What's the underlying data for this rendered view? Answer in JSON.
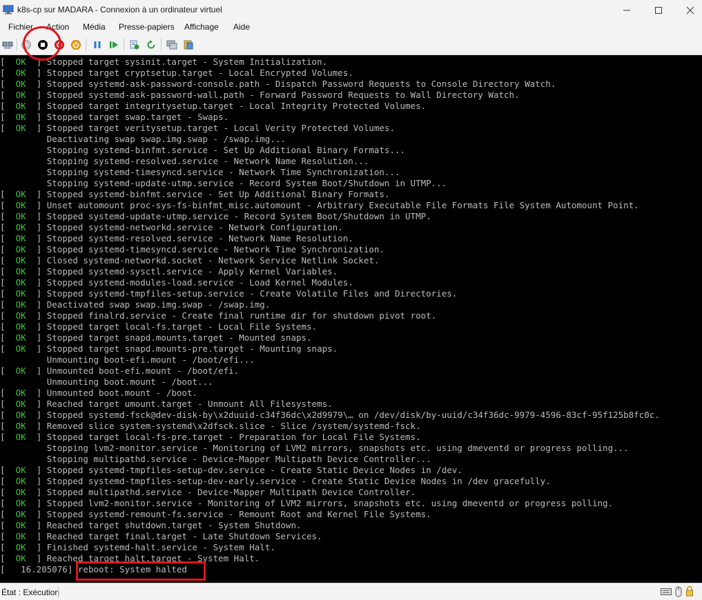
{
  "window": {
    "title": "k8s-cp sur MADARA - Connexion à un ordinateur virtuel"
  },
  "menu": [
    {
      "label": "Fichier"
    },
    {
      "label": "Action"
    },
    {
      "label": "Média"
    },
    {
      "label": "Presse-papiers"
    },
    {
      "label": "Affichage"
    },
    {
      "label": "Aide"
    }
  ],
  "toolbar": {
    "icons": [
      "ctrl-alt-del-icon",
      "start-icon",
      "turn-off-icon",
      "shutdown-icon",
      "power-icon",
      "pause-icon",
      "resume-icon",
      "checkpoint-icon",
      "revert-icon",
      "enhanced-session-icon",
      "share-icon"
    ],
    "highlighted": "turn-off-icon"
  },
  "colors": {
    "ok": "#3fc53f",
    "console_text": "#bcbcbc",
    "console_bg": "#000000",
    "annotation": "#e0141c"
  },
  "console": {
    "lines": [
      {
        "ok": true,
        "text": "Stopped target sysinit.target - System Initialization."
      },
      {
        "ok": true,
        "text": "Stopped target cryptsetup.target - Local Encrypted Volumes."
      },
      {
        "ok": true,
        "text": "Stopped systemd-ask-password-console.path - Dispatch Password Requests to Console Directory Watch."
      },
      {
        "ok": true,
        "text": "Stopped systemd-ask-password-wall.path - Forward Password Requests to Wall Directory Watch."
      },
      {
        "ok": true,
        "text": "Stopped target integritysetup.target - Local Integrity Protected Volumes."
      },
      {
        "ok": true,
        "text": "Stopped target swap.target - Swaps."
      },
      {
        "ok": true,
        "text": "Stopped target veritysetup.target - Local Verity Protected Volumes."
      },
      {
        "ok": false,
        "text": "Deactivating swap swap.img.swap - /swap.img..."
      },
      {
        "ok": false,
        "text": "Stopping systemd-binfmt.service - Set Up Additional Binary Formats..."
      },
      {
        "ok": false,
        "text": "Stopping systemd-resolved.service - Network Name Resolution..."
      },
      {
        "ok": false,
        "text": "Stopping systemd-timesyncd.service - Network Time Synchronization..."
      },
      {
        "ok": false,
        "text": "Stopping systemd-update-utmp.service - Record System Boot/Shutdown in UTMP..."
      },
      {
        "ok": true,
        "text": "Stopped systemd-binfmt.service - Set Up Additional Binary Formats."
      },
      {
        "ok": true,
        "text": "Unset automount proc-sys-fs-binfmt_misc.automount - Arbitrary Executable File Formats File System Automount Point."
      },
      {
        "ok": true,
        "text": "Stopped systemd-update-utmp.service - Record System Boot/Shutdown in UTMP."
      },
      {
        "ok": true,
        "text": "Stopped systemd-networkd.service - Network Configuration."
      },
      {
        "ok": true,
        "text": "Stopped systemd-resolved.service - Network Name Resolution."
      },
      {
        "ok": true,
        "text": "Stopped systemd-timesyncd.service - Network Time Synchronization."
      },
      {
        "ok": true,
        "text": "Closed systemd-networkd.socket - Network Service Netlink Socket."
      },
      {
        "ok": true,
        "text": "Stopped systemd-sysctl.service - Apply Kernel Variables."
      },
      {
        "ok": true,
        "text": "Stopped systemd-modules-load.service - Load Kernel Modules."
      },
      {
        "ok": true,
        "text": "Stopped systemd-tmpfiles-setup.service - Create Volatile Files and Directories."
      },
      {
        "ok": true,
        "text": "Deactivated swap swap.img.swap - /swap.img."
      },
      {
        "ok": true,
        "text": "Stopped finalrd.service - Create final runtime dir for shutdown pivot root."
      },
      {
        "ok": true,
        "text": "Stopped target local-fs.target - Local File Systems."
      },
      {
        "ok": true,
        "text": "Stopped target snapd.mounts.target - Mounted snaps."
      },
      {
        "ok": true,
        "text": "Stopped target snapd.mounts-pre.target - Mounting snaps."
      },
      {
        "ok": false,
        "text": "Unmounting boot-efi.mount - /boot/efi..."
      },
      {
        "ok": true,
        "text": "Unmounted boot-efi.mount - /boot/efi."
      },
      {
        "ok": false,
        "text": "Unmounting boot.mount - /boot..."
      },
      {
        "ok": true,
        "text": "Unmounted boot.mount - /boot."
      },
      {
        "ok": true,
        "text": "Reached target umount.target - Unmount All Filesystems."
      },
      {
        "ok": true,
        "text": "Stopped systemd-fsck@dev-disk-by\\x2duuid-c34f36dc\\x2d9979\\… on /dev/disk/by-uuid/c34f36dc-9979-4596-83cf-95f125b8fc0c."
      },
      {
        "ok": true,
        "text": "Removed slice system-systemd\\x2dfsck.slice - Slice /system/systemd-fsck."
      },
      {
        "ok": true,
        "text": "Stopped target local-fs-pre.target - Preparation for Local File Systems."
      },
      {
        "ok": false,
        "text": "Stopping lvm2-monitor.service - Monitoring of LVM2 mirrors, snapshots etc. using dmeventd or progress polling..."
      },
      {
        "ok": false,
        "text": "Stopping multipathd.service - Device-Mapper Multipath Device Controller..."
      },
      {
        "ok": true,
        "text": "Stopped systemd-tmpfiles-setup-dev.service - Create Static Device Nodes in /dev."
      },
      {
        "ok": true,
        "text": "Stopped systemd-tmpfiles-setup-dev-early.service - Create Static Device Nodes in /dev gracefully."
      },
      {
        "ok": true,
        "text": "Stopped multipathd.service - Device-Mapper Multipath Device Controller."
      },
      {
        "ok": true,
        "text": "Stopped lvm2-monitor.service - Monitoring of LVM2 mirrors, snapshots etc. using dmeventd or progress polling."
      },
      {
        "ok": true,
        "text": "Stopped systemd-remount-fs.service - Remount Root and Kernel File Systems."
      },
      {
        "ok": true,
        "text": "Reached target shutdown.target - System Shutdown."
      },
      {
        "ok": true,
        "text": "Reached target final.target - Late Shutdown Services."
      },
      {
        "ok": true,
        "text": "Finished systemd-halt.service - System Halt."
      },
      {
        "ok": true,
        "text": "Reached target halt.target - System Halt."
      }
    ],
    "final_line": {
      "timestamp": "[   16.205076]",
      "message": "reboot: System halted"
    }
  },
  "status": {
    "text": "État : Exécution"
  }
}
